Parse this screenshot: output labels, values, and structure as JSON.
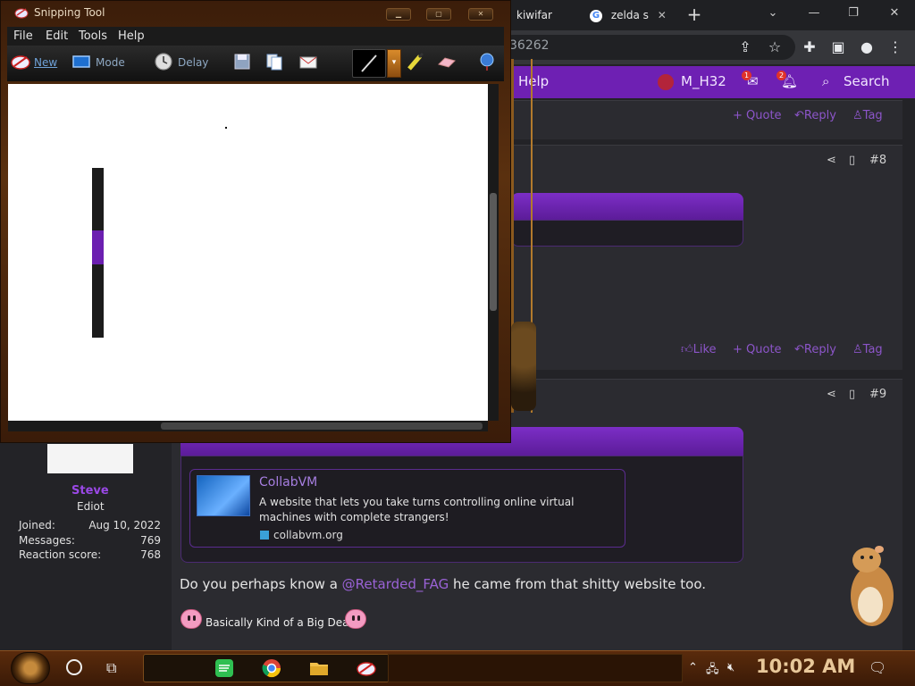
{
  "browser": {
    "tabs": [
      {
        "title": "kiwifar",
        "favicon": "kiwi"
      },
      {
        "title": "zelda s",
        "favicon": "google-g"
      }
    ],
    "url_fragment": "36262",
    "new_tab_glyph": "+",
    "nav": {
      "help_label": "Help",
      "username": "M_H32",
      "inbox_badge": "1",
      "alerts_badge": "2",
      "search_label": "Search"
    }
  },
  "posts": {
    "actions": {
      "like": "Like",
      "quote": "+ Quote",
      "reply": "Reply",
      "tag": "Tag"
    },
    "post8_number": "#8",
    "post9_number": "#9",
    "link_card": {
      "title": "CollabVM",
      "description": "A website that lets you take turns controlling online virtual machines with complete strangers!",
      "domain": "collabvm.org"
    },
    "body_before": "Do you perhaps know a ",
    "mention": "@Retarded_FAG",
    "body_after": " he came from that shitty website too.",
    "signature": "Basically Kind of a Big Deal"
  },
  "user": {
    "name": "Steve",
    "title": "Ediot",
    "joined_label": "Joined:",
    "joined_value": "Aug 10, 2022",
    "messages_label": "Messages:",
    "messages_value": "769",
    "reaction_label": "Reaction score:",
    "reaction_value": "768"
  },
  "snipping_tool": {
    "title": "Snipping Tool",
    "menu": [
      "File",
      "Edit",
      "Tools",
      "Help"
    ],
    "new_label": "New",
    "mode_label": "Mode",
    "delay_label": "Delay",
    "pen_dropdown_glyph": "▾"
  },
  "taskbar": {
    "clock": "10:02 AM"
  },
  "colors": {
    "accent_purple": "#6e20b3",
    "link_purple": "#8c55c9",
    "clock": "#e8c89a"
  }
}
